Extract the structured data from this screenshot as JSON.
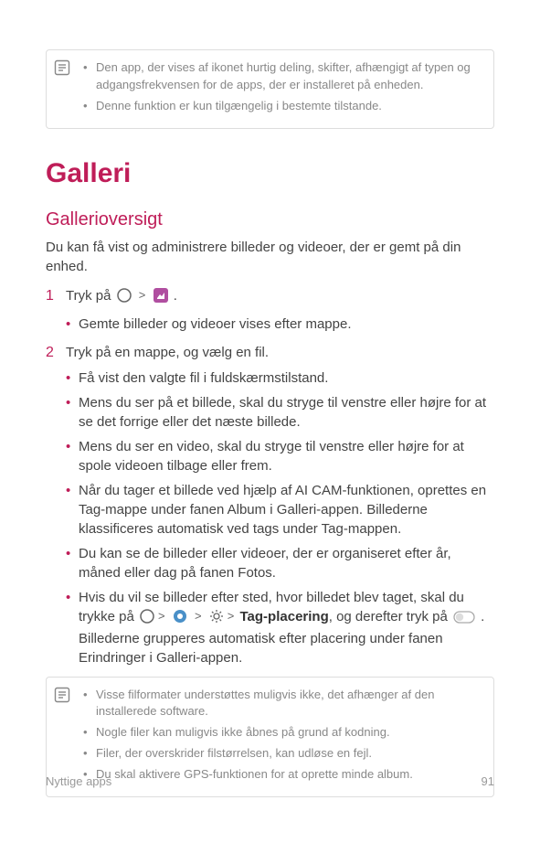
{
  "note1": {
    "items": [
      "Den app, der vises af ikonet hurtig deling, skifter, afhængigt af typen og adgangsfrekvensen for de apps, der er installeret på enheden.",
      "Denne funktion er kun tilgængelig i bestemte tilstande."
    ]
  },
  "h1": "Galleri",
  "h2": "Gallerioversigt",
  "intro": "Du kan få vist og administrere billeder og videoer, der er gemt på din enhed.",
  "steps": {
    "s1": {
      "num": "1",
      "text_before": "Tryk på ",
      "sub": [
        "Gemte billeder og videoer vises efter mappe."
      ]
    },
    "s2": {
      "num": "2",
      "text": "Tryk på en mappe, og vælg en fil.",
      "sub": {
        "a": "Få vist den valgte fil i fuldskærmstilstand.",
        "b": "Mens du ser på et billede, skal du stryge til venstre eller højre for at se det forrige eller det næste billede.",
        "c": "Mens du ser en video, skal du stryge til venstre eller højre for at spole videoen tilbage eller frem.",
        "d": "Når du tager et billede ved hjælp af AI CAM-funktionen, oprettes en Tag-mappe under fanen Album i Galleri-appen. Billederne klassificeres automatisk ved tags under Tag-mappen.",
        "e": "Du kan se de billeder eller videoer, der er organiseret efter år, måned eller dag på fanen Fotos.",
        "f_before": "Hvis du vil se billeder efter sted, hvor billedet blev taget, skal du trykke på ",
        "f_tag": "Tag-placering",
        "f_after1": ", og derefter tryk på ",
        "f_after2": ". Billederne grupperes automatisk efter placering under fanen Erindringer i Galleri-appen."
      }
    }
  },
  "note2": {
    "items": [
      "Visse filformater understøttes muligvis ikke, det afhænger af den installerede software.",
      "Nogle filer kan muligvis ikke åbnes på grund af kodning.",
      "Filer, der overskrider filstørrelsen, kan udløse en fejl.",
      "Du skal aktivere GPS-funktionen for at oprette minde album."
    ]
  },
  "footer": {
    "left": "Nyttige apps",
    "right": "91"
  }
}
